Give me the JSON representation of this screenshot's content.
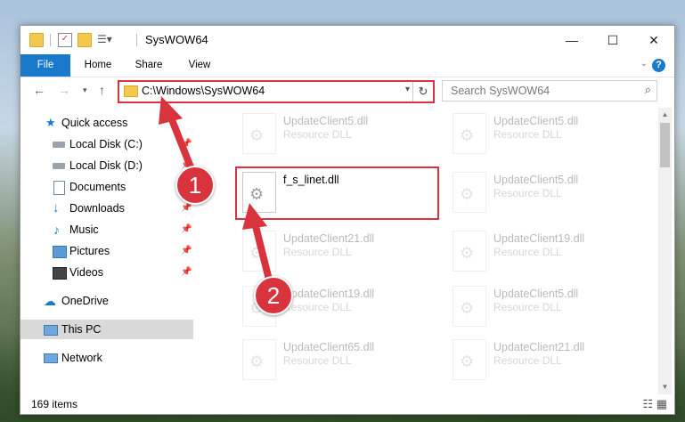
{
  "window": {
    "title": "SysWOW64",
    "controls": {
      "minimize": "—",
      "maximize": "☐",
      "close": "✕"
    }
  },
  "ribbon": {
    "tabs": [
      "File",
      "Home",
      "Share",
      "View"
    ]
  },
  "address": {
    "path": "C:\\Windows\\SysWOW64",
    "search_placeholder": "Search SysWOW64"
  },
  "sidebar": {
    "items": [
      {
        "label": "Quick access",
        "icon": "star-icon",
        "pinned": false
      },
      {
        "label": "Local Disk (C:)",
        "icon": "drive-icon",
        "pinned": true
      },
      {
        "label": "Local Disk (D:)",
        "icon": "drive-icon",
        "pinned": true
      },
      {
        "label": "Documents",
        "icon": "documents-icon",
        "pinned": true
      },
      {
        "label": "Downloads",
        "icon": "downloads-icon",
        "pinned": true
      },
      {
        "label": "Music",
        "icon": "music-icon",
        "pinned": true
      },
      {
        "label": "Pictures",
        "icon": "pictures-icon",
        "pinned": true
      },
      {
        "label": "Videos",
        "icon": "videos-icon",
        "pinned": true
      },
      {
        "label": "OneDrive",
        "icon": "cloud-icon",
        "pinned": false
      },
      {
        "label": "This PC",
        "icon": "computer-icon",
        "pinned": false,
        "selected": true
      },
      {
        "label": "Network",
        "icon": "network-icon",
        "pinned": false
      }
    ]
  },
  "files": {
    "left_column": [
      {
        "name": "UpdateClient5.dll",
        "type": "Resource DLL"
      },
      {
        "name": "f_s_linet.dll",
        "type": ""
      },
      {
        "name": "UpdateClient21.dll",
        "type": "Resource DLL"
      },
      {
        "name": "UpdateClient19.dll",
        "type": "Resource DLL"
      },
      {
        "name": "UpdateClient65.dll",
        "type": "Resource DLL"
      }
    ],
    "right_column": [
      {
        "name": "UpdateClient5.dll",
        "type": "Resource DLL"
      },
      {
        "name": "UpdateClient5.dll",
        "type": "Resource DLL"
      },
      {
        "name": "UpdateClient19.dll",
        "type": "Resource DLL"
      },
      {
        "name": "UpdateClient5.dll",
        "type": "Resource DLL"
      },
      {
        "name": "UpdateClient21.dll",
        "type": "Resource DLL"
      }
    ]
  },
  "status": {
    "item_count": "169 items"
  },
  "callouts": {
    "step1": "1",
    "step2": "2"
  },
  "colors": {
    "accent": "#1979ca",
    "callout": "#d9343e",
    "selected": "#d9d9d9"
  }
}
